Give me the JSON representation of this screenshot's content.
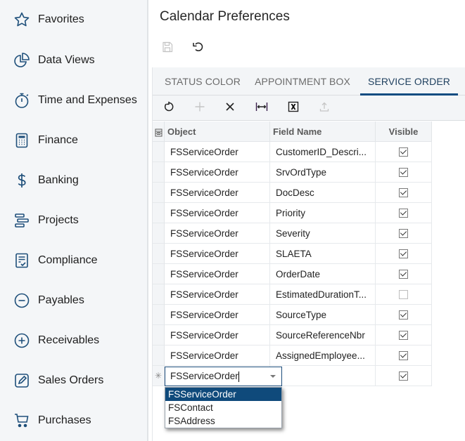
{
  "sidebar": {
    "items": [
      {
        "label": "Favorites",
        "icon": "star-icon"
      },
      {
        "label": "Data Views",
        "icon": "pie-chart-icon"
      },
      {
        "label": "Time and Expenses",
        "icon": "stopwatch-icon"
      },
      {
        "label": "Finance",
        "icon": "calculator-icon"
      },
      {
        "label": "Banking",
        "icon": "dollar-icon"
      },
      {
        "label": "Projects",
        "icon": "gantt-icon"
      },
      {
        "label": "Compliance",
        "icon": "checklist-icon"
      },
      {
        "label": "Payables",
        "icon": "minus-circle-icon"
      },
      {
        "label": "Receivables",
        "icon": "plus-circle-icon"
      },
      {
        "label": "Sales Orders",
        "icon": "pencil-square-icon"
      },
      {
        "label": "Purchases",
        "icon": "cart-icon"
      }
    ]
  },
  "header": {
    "title": "Calendar Preferences",
    "toolbar": [
      {
        "name": "save",
        "icon": "save-icon",
        "enabled": false
      },
      {
        "name": "undo",
        "icon": "undo-icon",
        "enabled": true
      }
    ]
  },
  "tabs": [
    {
      "label": "STATUS COLOR",
      "active": false
    },
    {
      "label": "APPOINTMENT BOX",
      "active": false
    },
    {
      "label": "SERVICE ORDER",
      "active": true
    }
  ],
  "grid_toolbar": [
    {
      "name": "refresh",
      "icon": "refresh-icon",
      "enabled": true
    },
    {
      "name": "add-row",
      "icon": "plus-icon",
      "enabled": false
    },
    {
      "name": "delete-row",
      "icon": "close-icon",
      "enabled": true
    },
    {
      "name": "fit-to-screen",
      "icon": "fit-width-icon",
      "enabled": true
    },
    {
      "name": "export-excel",
      "icon": "excel-icon",
      "enabled": true
    },
    {
      "name": "upload",
      "icon": "upload-icon",
      "enabled": false
    }
  ],
  "grid": {
    "columns": [
      "Object",
      "Field Name",
      "Visible"
    ],
    "rows": [
      {
        "object": "FSServiceOrder",
        "field": "CustomerID_Descri...",
        "visible": true
      },
      {
        "object": "FSServiceOrder",
        "field": "SrvOrdType",
        "visible": true
      },
      {
        "object": "FSServiceOrder",
        "field": "DocDesc",
        "visible": true
      },
      {
        "object": "FSServiceOrder",
        "field": "Priority",
        "visible": true
      },
      {
        "object": "FSServiceOrder",
        "field": "Severity",
        "visible": true
      },
      {
        "object": "FSServiceOrder",
        "field": "SLAETA",
        "visible": true
      },
      {
        "object": "FSServiceOrder",
        "field": "OrderDate",
        "visible": true
      },
      {
        "object": "FSServiceOrder",
        "field": "EstimatedDurationT...",
        "visible": false
      },
      {
        "object": "FSServiceOrder",
        "field": "SourceType",
        "visible": true
      },
      {
        "object": "FSServiceOrder",
        "field": "SourceReferenceNbr",
        "visible": true
      },
      {
        "object": "FSServiceOrder",
        "field": "AssignedEmployee...",
        "visible": true
      }
    ],
    "new_row": {
      "marker": "✳",
      "object_value": "FSServiceOrder",
      "field": "",
      "visible": true
    },
    "dropdown_options": [
      {
        "label": "FSServiceOrder",
        "selected": true
      },
      {
        "label": "FSContact",
        "selected": false
      },
      {
        "label": "FSAddress",
        "selected": false
      }
    ]
  },
  "colors": {
    "accent": "#0f4c81",
    "sidebar_bg": "#f4f6f8",
    "icon_blue": "#1e4f7a",
    "selected_option_bg": "#0f4a7b"
  }
}
